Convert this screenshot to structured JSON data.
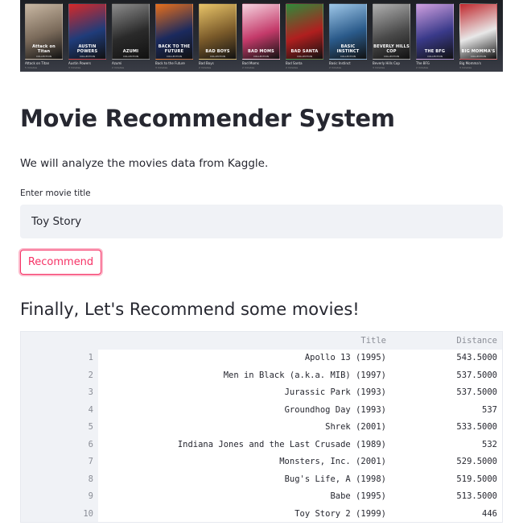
{
  "banner": {
    "posters": [
      {
        "title": "Attack on Titan",
        "label": "Attack on Titan",
        "sub": "5 minutes",
        "color": "#7a6a5a",
        "accent": "#c9b8a3"
      },
      {
        "title": "AUSTIN POWERS",
        "label": "Austin Powers",
        "sub": "3 minutes",
        "color": "#1f3c7a",
        "accent": "#d62828"
      },
      {
        "title": "AZUMI",
        "label": "Azumi",
        "sub": "2 minutes",
        "color": "#2a2a2a",
        "accent": "#8c8c8c"
      },
      {
        "title": "BACK TO THE FUTURE",
        "label": "Back to the Future",
        "sub": "3 minutes",
        "color": "#1b2a5e",
        "accent": "#e76f1b"
      },
      {
        "title": "BAD BOYS",
        "label": "Bad Boys",
        "sub": "2 minutes",
        "color": "#7a5a2a",
        "accent": "#e8c468"
      },
      {
        "title": "BAD MOMS",
        "label": "Bad Moms",
        "sub": "2 minutes",
        "color": "#c43a6a",
        "accent": "#f5d3df"
      },
      {
        "title": "BAD SANTA",
        "label": "Bad Santa",
        "sub": "2 minutes",
        "color": "#b01f1f",
        "accent": "#2e8b3a"
      },
      {
        "title": "BASIC INSTINCT",
        "label": "Basic Instinct",
        "sub": "2 minutes",
        "color": "#2a5a8a",
        "accent": "#9ec7e8"
      },
      {
        "title": "BEVERLY HILLS COP",
        "label": "Beverly Hills Cop",
        "sub": "3 minutes",
        "color": "#4a4a4a",
        "accent": "#b0b0b0"
      },
      {
        "title": "THE BFG",
        "label": "The BFG",
        "sub": "2 minutes",
        "color": "#3a3a8a",
        "accent": "#d0a0e0"
      },
      {
        "title": "BIG MOMMA'S",
        "label": "Big Momma's",
        "sub": "3 minutes",
        "color": "#e8e8e8",
        "accent": "#c0282d"
      }
    ]
  },
  "title": "Movie Recommender System",
  "subtitle": "We will analyze the movies data from Kaggle.",
  "input": {
    "label": "Enter movie title",
    "value": "Toy Story"
  },
  "button": {
    "label": "Recommend"
  },
  "results_heading": "Finally, Let's Recommend some movies!",
  "table": {
    "columns": [
      "Title",
      "Distance"
    ],
    "rows": [
      {
        "index": "1",
        "title": "Apollo 13 (1995)",
        "distance": "543.5000"
      },
      {
        "index": "2",
        "title": "Men in Black (a.k.a. MIB) (1997)",
        "distance": "537.5000"
      },
      {
        "index": "3",
        "title": "Jurassic Park (1993)",
        "distance": "537.5000"
      },
      {
        "index": "4",
        "title": "Groundhog Day (1993)",
        "distance": "537"
      },
      {
        "index": "5",
        "title": "Shrek (2001)",
        "distance": "533.5000"
      },
      {
        "index": "6",
        "title": "Indiana Jones and the Last Crusade (1989)",
        "distance": "532"
      },
      {
        "index": "7",
        "title": "Monsters, Inc. (2001)",
        "distance": "529.5000"
      },
      {
        "index": "8",
        "title": "Bug's Life, A (1998)",
        "distance": "519.5000"
      },
      {
        "index": "9",
        "title": "Babe (1995)",
        "distance": "513.5000"
      },
      {
        "index": "10",
        "title": "Toy Story 2 (1999)",
        "distance": "446"
      }
    ]
  }
}
